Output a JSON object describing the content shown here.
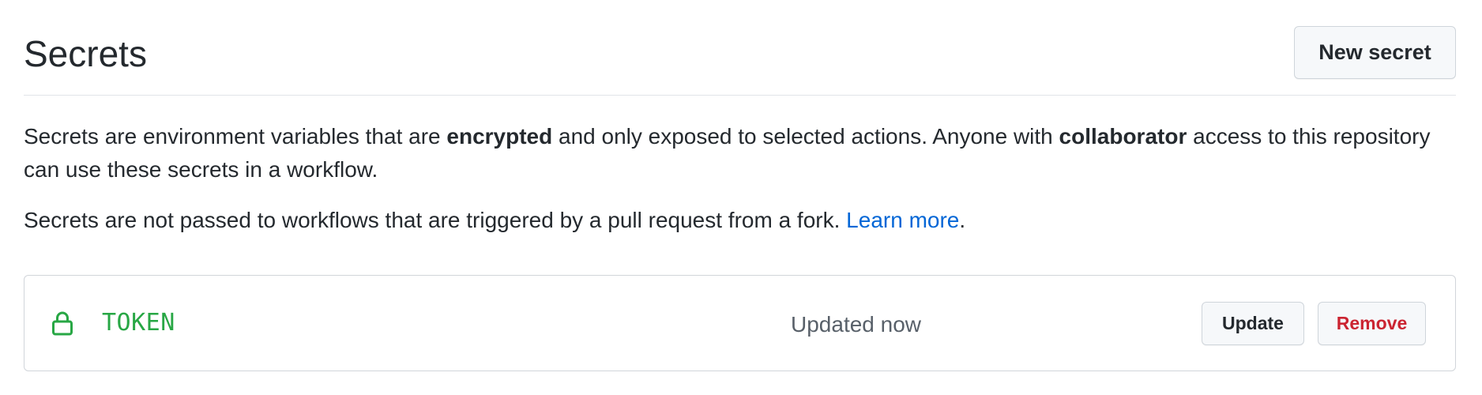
{
  "header": {
    "title": "Secrets",
    "new_button": "New secret"
  },
  "description": {
    "part1": "Secrets are environment variables that are ",
    "bold1": "encrypted",
    "part2": " and only exposed to selected actions. Anyone with ",
    "bold2": "collaborator",
    "part3": " access to this repository can use these secrets in a workflow."
  },
  "note": {
    "text": "Secrets are not passed to workflows that are triggered by a pull request from a fork. ",
    "link": "Learn more",
    "end": "."
  },
  "secrets": [
    {
      "icon": "lock-icon",
      "name": "TOKEN",
      "updated": "Updated now",
      "update_label": "Update",
      "remove_label": "Remove"
    }
  ],
  "colors": {
    "name": "#28a745",
    "remove": "#cb2431",
    "link": "#0366d6"
  }
}
